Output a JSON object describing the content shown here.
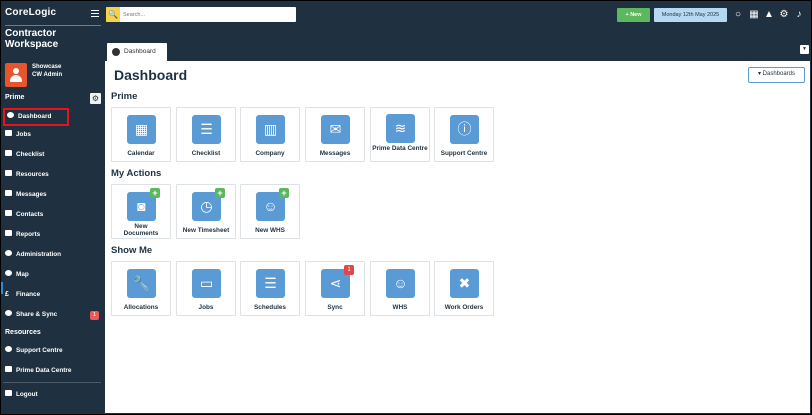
{
  "brand": {
    "line1": "CoreLogic",
    "line2": "Contractor Workspace"
  },
  "user": {
    "name": "Showcase",
    "role": "CW Admin",
    "avatar_color": "#e8542b"
  },
  "sidebar": {
    "prime_label": "Prime",
    "items": [
      {
        "label": "Dashboard",
        "icon": "dashboard-icon"
      },
      {
        "label": "Jobs",
        "icon": "folder-icon"
      },
      {
        "label": "Checklist",
        "icon": "checklist-icon"
      },
      {
        "label": "Resources",
        "icon": "resources-icon"
      },
      {
        "label": "Messages",
        "icon": "envelope-icon"
      },
      {
        "label": "Contacts",
        "icon": "contacts-icon"
      },
      {
        "label": "Reports",
        "icon": "chart-icon"
      },
      {
        "label": "Administration",
        "icon": "gear-icon"
      },
      {
        "label": "Map",
        "icon": "globe-icon"
      },
      {
        "label": "Finance",
        "icon": "pound-icon"
      },
      {
        "label": "Share & Sync",
        "icon": "share-icon",
        "badge": "1"
      }
    ],
    "resources_label": "Resources",
    "resource_items": [
      {
        "label": "Support Centre",
        "icon": "support-icon"
      },
      {
        "label": "Prime Data Centre",
        "icon": "database-icon"
      }
    ],
    "logout_label": "Logout"
  },
  "topbar": {
    "search_placeholder": "Search...",
    "new_label": "+ New",
    "date_label": "Monday 12th May 2025"
  },
  "tabs": [
    {
      "label": "Dashboard"
    }
  ],
  "main": {
    "title": "Dashboard",
    "dashboards_label": "Dashboards",
    "groups": [
      {
        "title": "Prime",
        "tiles": [
          {
            "label": "Calendar",
            "icon": "calendar-icon"
          },
          {
            "label": "Checklist",
            "icon": "checklist-icon"
          },
          {
            "label": "Company",
            "icon": "building-icon"
          },
          {
            "label": "Messages",
            "icon": "envelope-icon"
          },
          {
            "label": "Prime Data Centre",
            "icon": "database-icon"
          },
          {
            "label": "Support Centre",
            "icon": "info-icon"
          }
        ]
      },
      {
        "title": "My Actions",
        "tiles": [
          {
            "label": "New Documents",
            "icon": "camera-icon",
            "plus": "+"
          },
          {
            "label": "New Timesheet",
            "icon": "clock-icon",
            "plus": "+"
          },
          {
            "label": "New WHS",
            "icon": "worker-icon",
            "plus": "+"
          }
        ]
      },
      {
        "title": "Show Me",
        "tiles": [
          {
            "label": "Allocations",
            "icon": "wrench-icon"
          },
          {
            "label": "Jobs",
            "icon": "folder-icon"
          },
          {
            "label": "Schedules",
            "icon": "schedule-icon"
          },
          {
            "label": "Sync",
            "icon": "share-icon",
            "badge": "1"
          },
          {
            "label": "WHS",
            "icon": "worker-icon"
          },
          {
            "label": "Work Orders",
            "icon": "tools-icon"
          }
        ]
      }
    ]
  },
  "colors": {
    "sidebar_bg": "#1f3140",
    "accent": "#5b9bd5",
    "green": "#5cb85c",
    "active_outline": "#e3141b"
  }
}
